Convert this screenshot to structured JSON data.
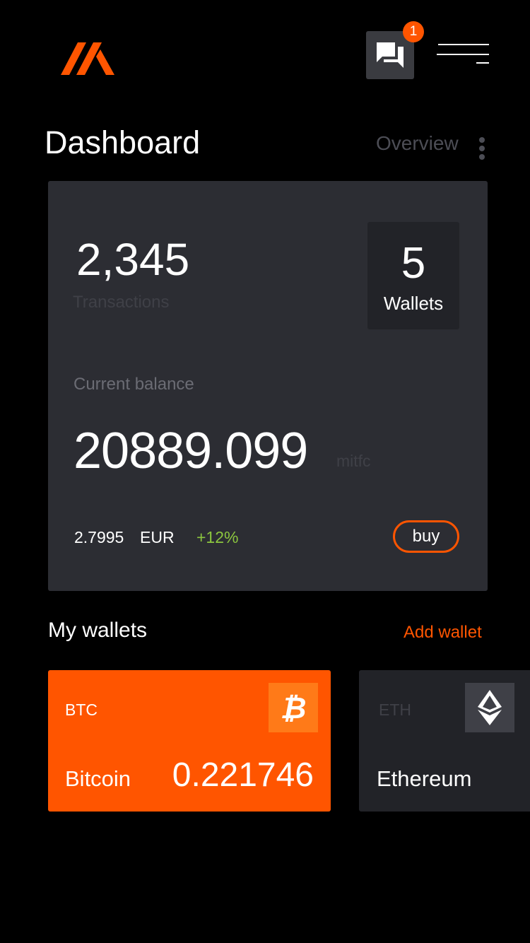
{
  "header": {
    "logo": "brand-logo",
    "chat_badge": "1"
  },
  "title_row": {
    "title": "Dashboard",
    "overview_label": "Overview"
  },
  "stats": {
    "transactions_count": "2,345",
    "transactions_label": "Transactions",
    "wallets_count": "5",
    "wallets_label": "Wallets"
  },
  "balance": {
    "label": "Current balance",
    "amount": "20889.099",
    "unit": "mitfc",
    "rate_value": "2.7995",
    "rate_currency": "EUR",
    "rate_change": "+12%",
    "buy_label": "buy"
  },
  "wallets_section": {
    "heading": "My wallets",
    "add_label": "Add wallet",
    "items": [
      {
        "code": "BTC",
        "name": "Bitcoin",
        "amount": "0.221746",
        "icon": "bitcoin-icon"
      },
      {
        "code": "ETH",
        "name": "Ethereum",
        "amount": "",
        "icon": "ethereum-icon"
      }
    ]
  },
  "colors": {
    "accent": "#ff5500",
    "card": "#2c2d33",
    "positive": "#8cc63f",
    "background": "#000000"
  }
}
